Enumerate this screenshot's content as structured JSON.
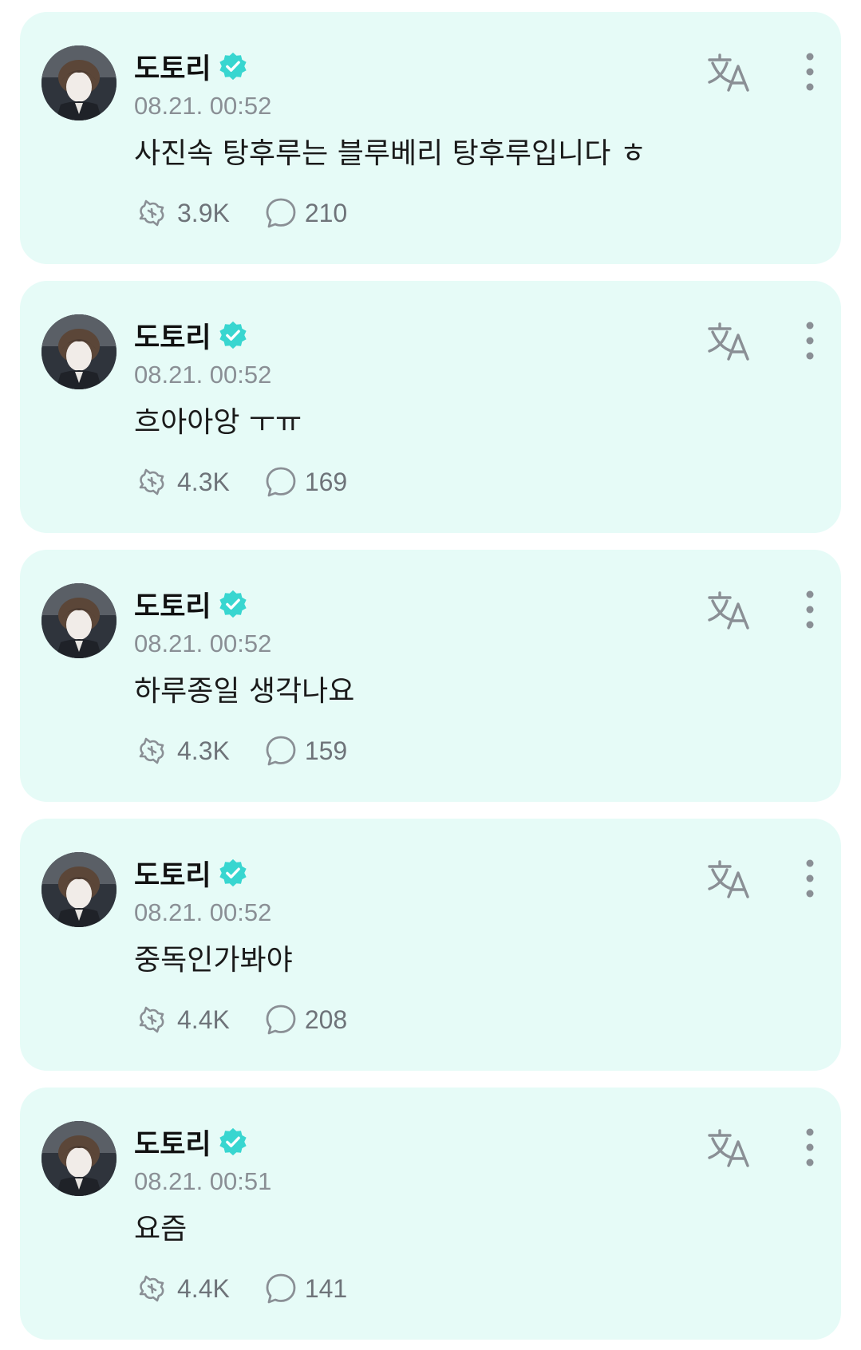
{
  "colors": {
    "card_background": "#e6fbf7",
    "verified_badge": "#38d6d0",
    "icon_gray": "#8a8f95"
  },
  "posts": [
    {
      "author": "도토리",
      "timestamp": "08.21. 00:52",
      "text": "사진속 탕후루는 블루베리 탕후루입니다 ㅎ",
      "reactions": "3.9K",
      "comments": "210"
    },
    {
      "author": "도토리",
      "timestamp": "08.21. 00:52",
      "text": "흐아아앙 ㅜㅠ",
      "reactions": "4.3K",
      "comments": "169"
    },
    {
      "author": "도토리",
      "timestamp": "08.21. 00:52",
      "text": "하루종일 생각나요",
      "reactions": "4.3K",
      "comments": "159"
    },
    {
      "author": "도토리",
      "timestamp": "08.21. 00:52",
      "text": "중독인가봐야",
      "reactions": "4.4K",
      "comments": "208"
    },
    {
      "author": "도토리",
      "timestamp": "08.21. 00:51",
      "text": "요즘",
      "reactions": "4.4K",
      "comments": "141"
    }
  ],
  "icons": {
    "verified": "verified-badge-icon",
    "translate": "translate-icon",
    "more": "more-vertical-icon",
    "reaction": "reaction-icon",
    "comment": "comment-bubble-icon"
  }
}
